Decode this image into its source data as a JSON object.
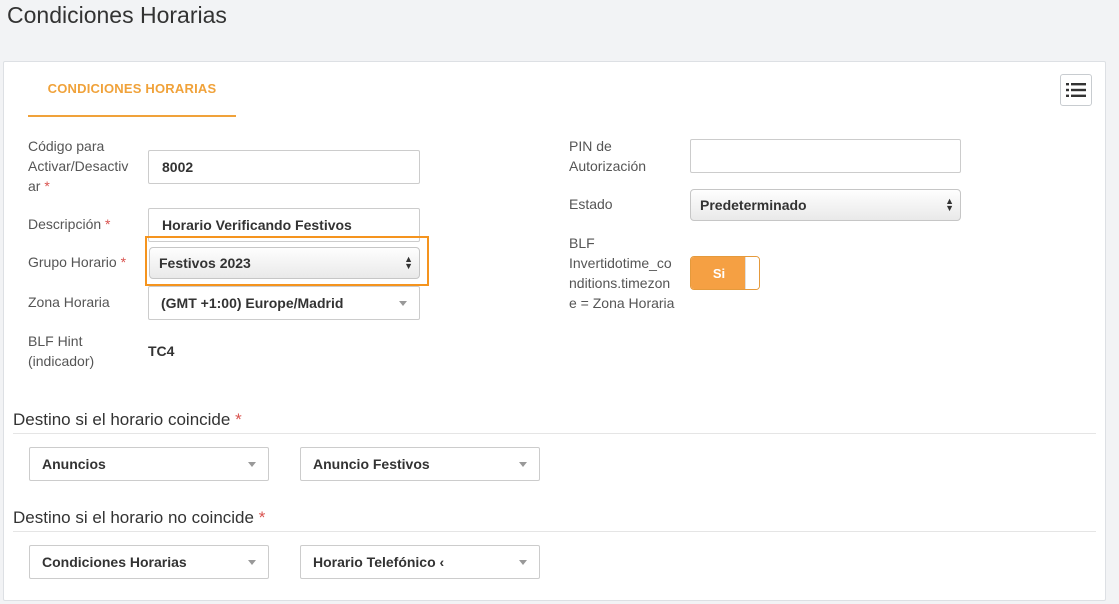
{
  "page": {
    "title": "Condiciones Horarias"
  },
  "tab": {
    "label": "CONDICIONES HORARIAS"
  },
  "toolbar": {
    "menu_icon": "list-menu-icon"
  },
  "form": {
    "codigo": {
      "label_lines": [
        "Código para",
        "Activar/Desactiv",
        "ar"
      ],
      "required": "*",
      "value": "8002"
    },
    "descripcion": {
      "label": "Descripción",
      "required": "*",
      "value": "Horario Verificando Festivos"
    },
    "grupo_horario": {
      "label": "Grupo Horario",
      "required": "*",
      "value": "Festivos 2023"
    },
    "zona_horaria": {
      "label": "Zona Horaria",
      "value": "(GMT +1:00) Europe/Madrid"
    },
    "blf_hint": {
      "label_lines": [
        "BLF Hint",
        "(indicador)"
      ],
      "value": "TC4"
    },
    "pin": {
      "label_lines": [
        "PIN de",
        "Autorización"
      ],
      "value": ""
    },
    "estado": {
      "label": "Estado",
      "value": "Predeterminado"
    },
    "blf_invertido": {
      "label_lines": [
        "BLF",
        "Invertidotime_co",
        "nditions.timezon",
        "e = Zona Horaria"
      ],
      "toggle_label": "Si"
    }
  },
  "destino_coincide": {
    "title": "Destino si el horario coincide",
    "required": "*",
    "type_value": "Anuncios",
    "target_value": "Anuncio Festivos"
  },
  "destino_no_coincide": {
    "title": "Destino si el horario no coincide",
    "required": "*",
    "type_value": "Condiciones Horarias",
    "target_value": "Horario Telefónico ‹"
  },
  "colors": {
    "accent": "#f0a23a",
    "highlight": "#f5941e",
    "required": "#d9534f"
  }
}
